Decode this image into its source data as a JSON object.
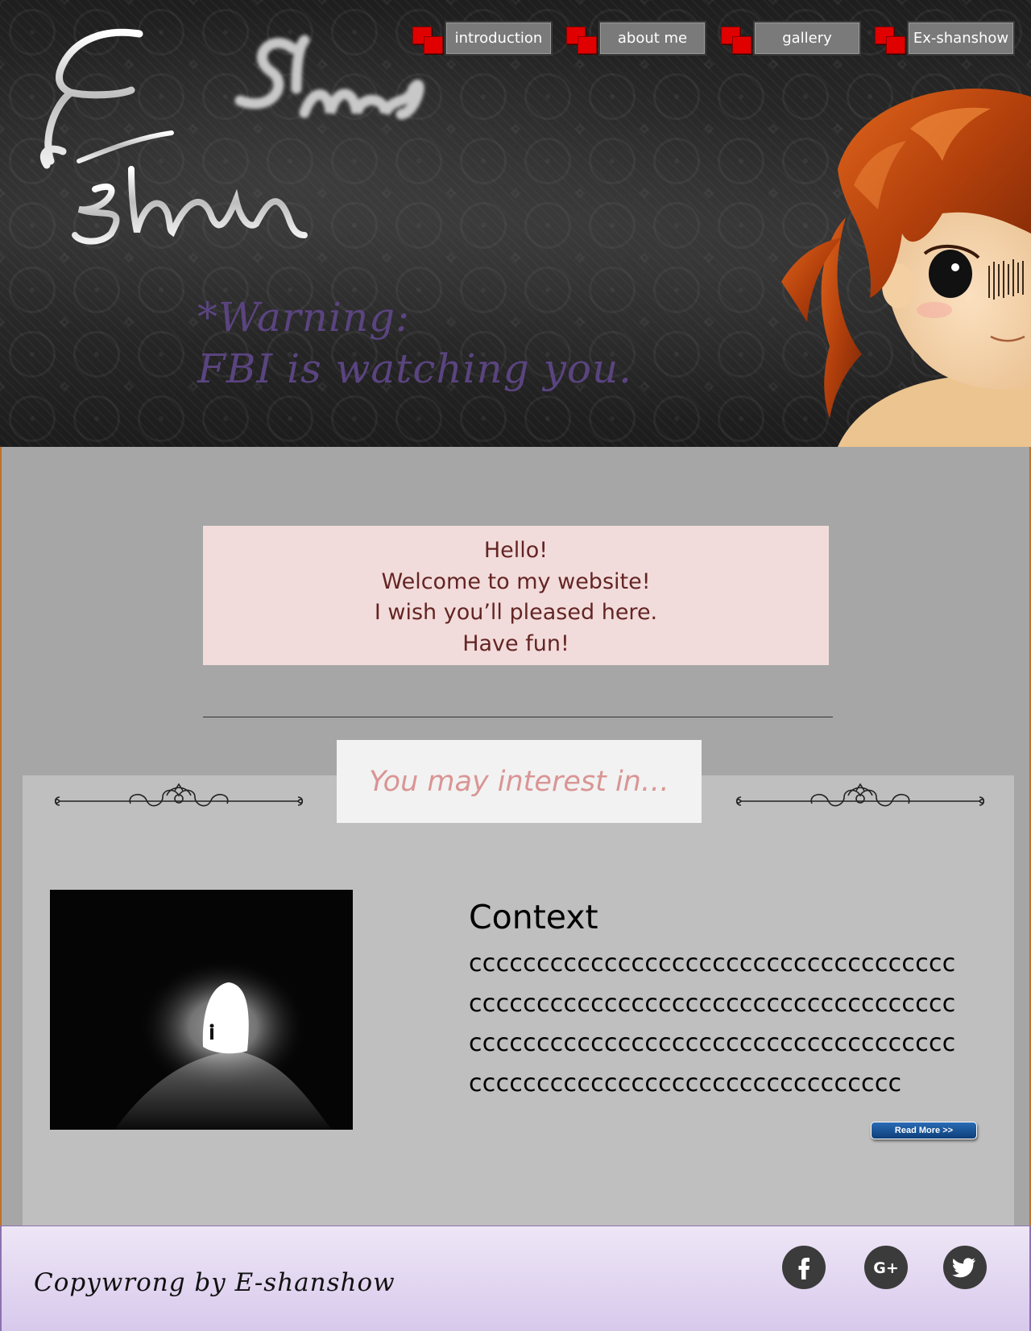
{
  "header": {
    "nav": [
      {
        "label": "introduction"
      },
      {
        "label": "about me"
      },
      {
        "label": "gallery"
      },
      {
        "label": "Ex-shanshow"
      }
    ],
    "warning_line1": "*Warning:",
    "warning_line2": "FBI is watching you.",
    "logo_text": "E-shan show"
  },
  "welcome": {
    "lines": [
      "Hello!",
      "Welcome to my website!",
      "I wish you’ll pleased here.",
      "Have fun!"
    ]
  },
  "section": {
    "title": "You may interest in…",
    "context_title": "Context",
    "context_lines": [
      "cccccccccccccccccccccccccccccccccccc",
      "cccccccccccccccccccccccccccccccccccc",
      "cccccccccccccccccccccccccccccccccccc",
      "cccccccccccccccccccccccccccccccc"
    ],
    "read_more": "Read More >>"
  },
  "footer": {
    "copyright": "Copywrong by E-shanshow",
    "social": [
      {
        "icon": "facebook-icon",
        "glyph": "f"
      },
      {
        "icon": "google-plus-icon",
        "glyph": "G+"
      },
      {
        "icon": "twitter-icon",
        "glyph": "bird"
      }
    ]
  },
  "colors": {
    "nav_accent": "#e00000",
    "welcome_bg": "#f2dcdb",
    "welcome_text": "#632523",
    "section_title": "#d99594",
    "warning_text": "#5a4480",
    "read_more_btn": "#0d3f7a"
  }
}
